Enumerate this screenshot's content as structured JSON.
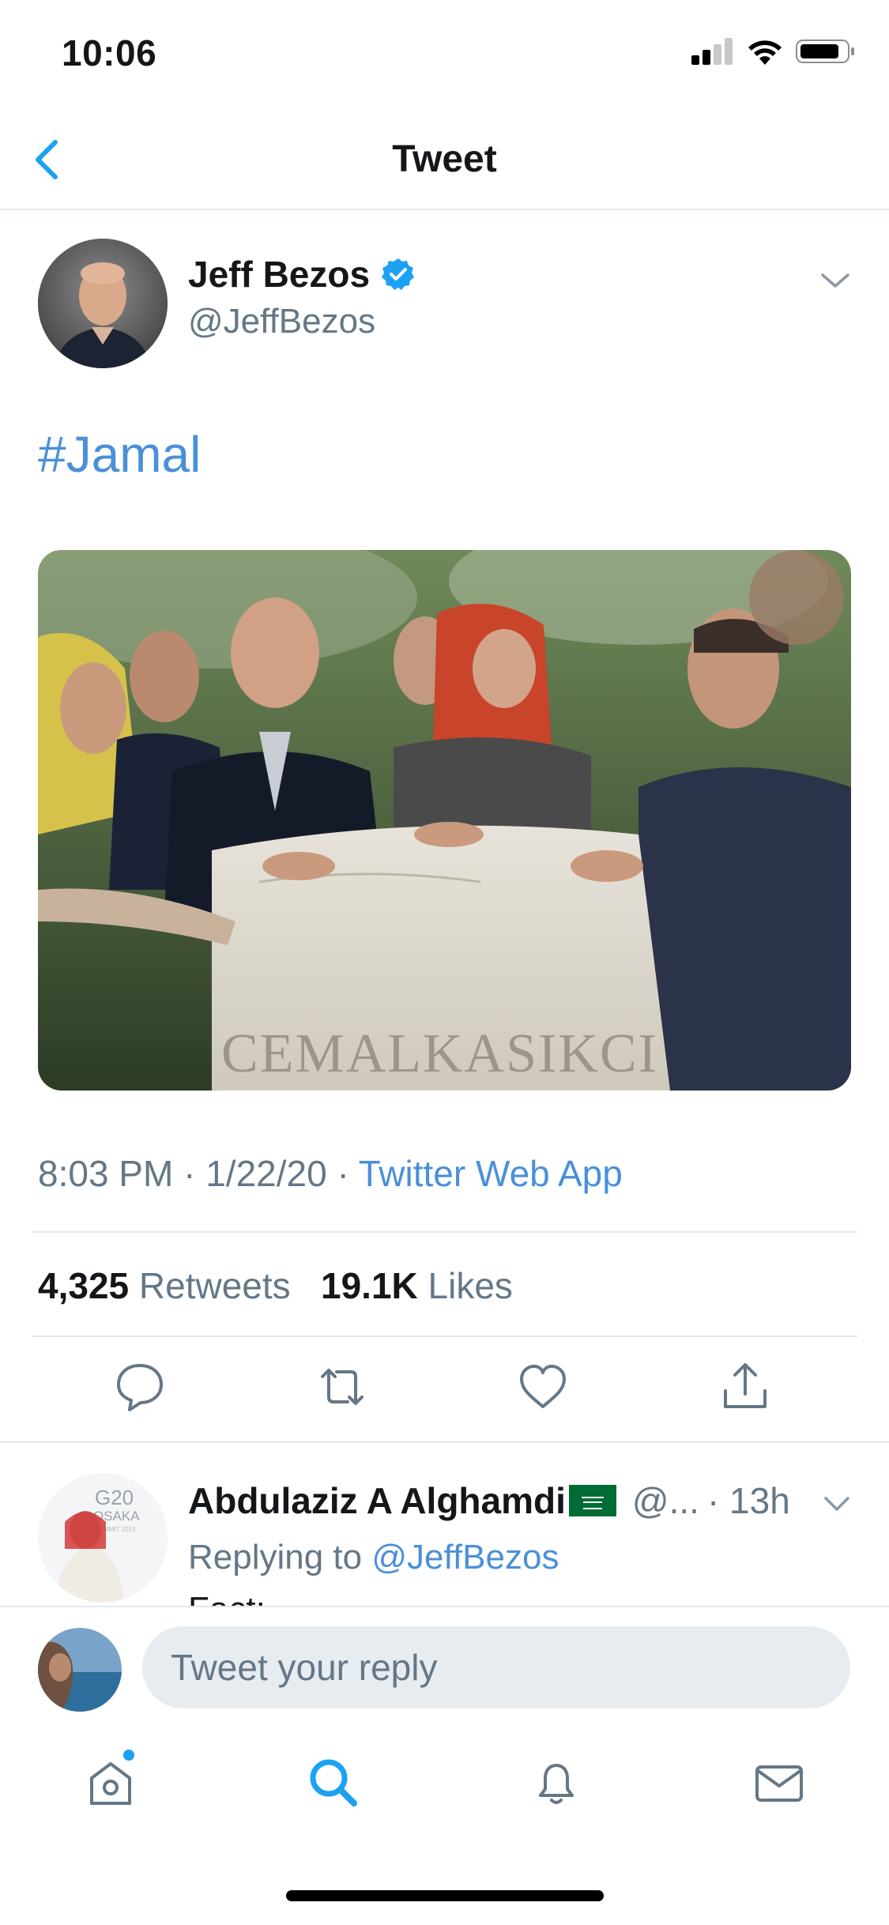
{
  "status_bar": {
    "time": "10:06"
  },
  "nav": {
    "title": "Tweet",
    "back_icon": "chevron-left-icon"
  },
  "tweet": {
    "author_name": "Jeff Bezos",
    "author_handle": "@JeffBezos",
    "verified": true,
    "text": "#Jamal",
    "photo_caption_text": "CEMALKASIKCI",
    "time": "8:03 PM",
    "date": "1/22/20",
    "separator": "·",
    "source": "Twitter Web App",
    "retweets_count": "4,325",
    "retweets_label": "Retweets",
    "likes_count": "19.1K",
    "likes_label": "Likes"
  },
  "reply": {
    "author_name": "Abdulaziz A Alghamdi",
    "author_handle": "@...",
    "time": "· 13h",
    "replying_prefix": "Replying to",
    "replying_to": "@JeffBezos",
    "text": "Fact:",
    "avatar_text": {
      "line1": "G20",
      "line2": "OSAKA",
      "line3": "SUMMIT 2019"
    }
  },
  "composer": {
    "placeholder": "Tweet your reply"
  },
  "tabbar": {
    "items": [
      "home-icon",
      "search-icon",
      "notifications-icon",
      "messages-icon"
    ],
    "active": "search-icon"
  },
  "colors": {
    "accent": "#1da1f2",
    "link": "#4a90d9",
    "secondary_text": "#657786",
    "divider": "#e1e8ed"
  }
}
